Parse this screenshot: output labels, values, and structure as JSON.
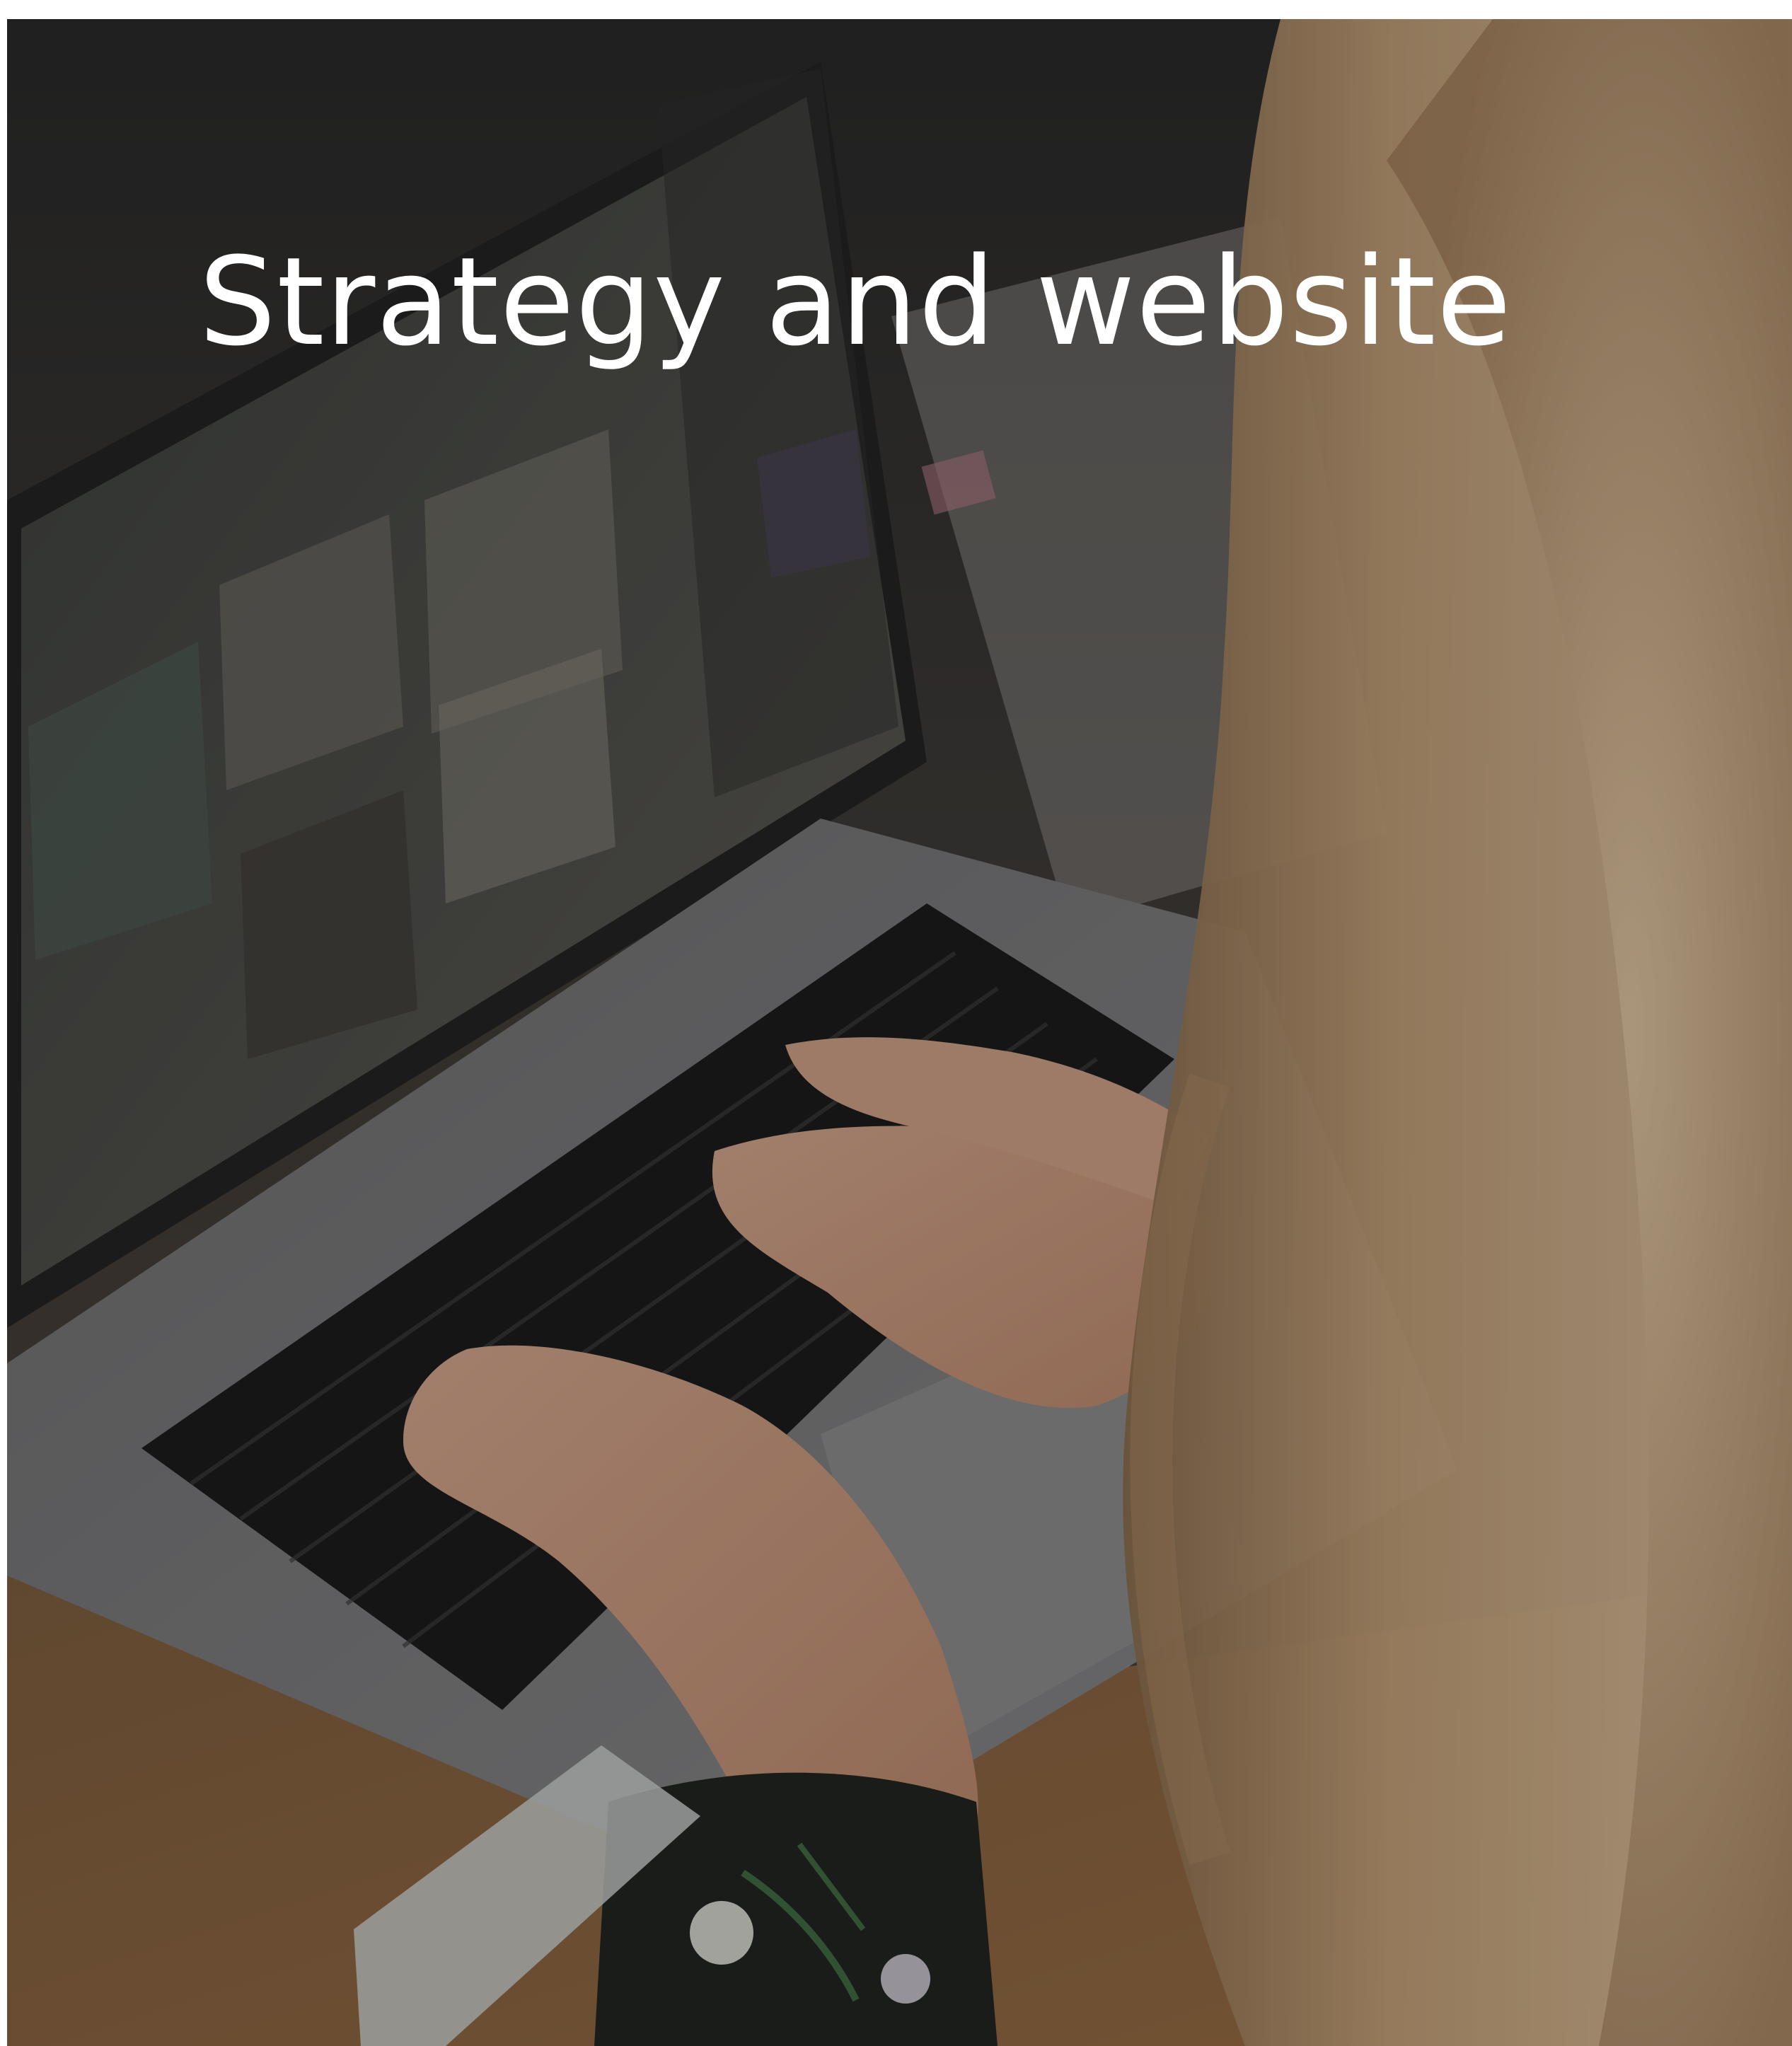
{
  "card": {
    "title": "Strategy and website",
    "image": "photo-of-person-typing-on-laptop"
  },
  "colors": {
    "title_text": "#ffffff",
    "overlay": "#141414"
  }
}
